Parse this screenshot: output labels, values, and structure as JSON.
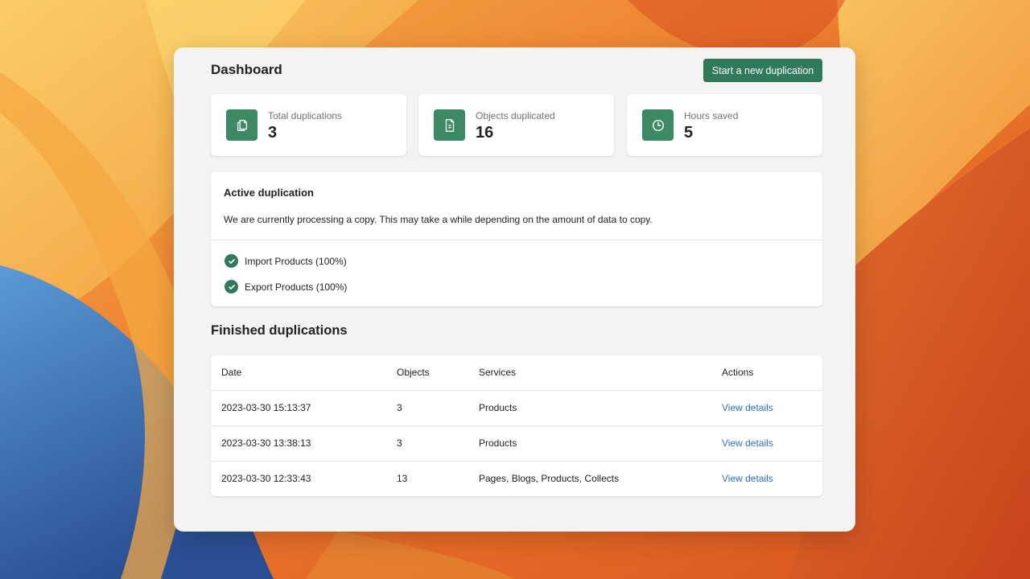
{
  "header": {
    "title": "Dashboard",
    "primary_button": "Start a new duplication"
  },
  "stats": [
    {
      "label": "Total duplications",
      "value": "3",
      "icon": "copy-icon"
    },
    {
      "label": "Objects duplicated",
      "value": "16",
      "icon": "document-icon"
    },
    {
      "label": "Hours saved",
      "value": "5",
      "icon": "clock-icon"
    }
  ],
  "active": {
    "title": "Active duplication",
    "description": "We are currently processing a copy. This may take a while depending on the amount of data to copy.",
    "tasks": [
      {
        "label": "Import Products (100%)",
        "progress": 100
      },
      {
        "label": "Export Products (100%)",
        "progress": 100
      }
    ]
  },
  "finished": {
    "title": "Finished duplications",
    "columns": [
      "Date",
      "Objects",
      "Services",
      "Actions"
    ],
    "rows": [
      {
        "date": "2023-03-30 15:13:37",
        "objects": "3",
        "services": "Products",
        "action": "View details"
      },
      {
        "date": "2023-03-30 13:38:13",
        "objects": "3",
        "services": "Products",
        "action": "View details"
      },
      {
        "date": "2023-03-30 12:33:43",
        "objects": "13",
        "services": "Pages, Blogs, Products, Collects",
        "action": "View details"
      }
    ]
  },
  "colors": {
    "accent": "#2f7a5a",
    "icon_bg": "#3b8a63",
    "link": "#2c6ecb",
    "window_bg": "#f3f3f3"
  }
}
